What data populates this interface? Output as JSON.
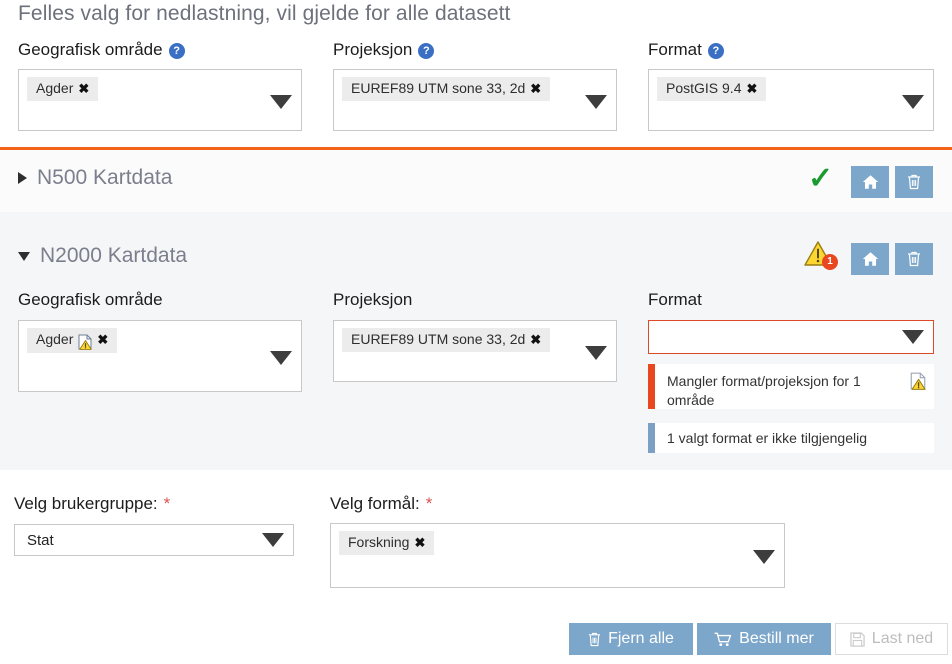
{
  "header": {
    "title": "Felles valg for nedlastning, vil gjelde for alle datasett"
  },
  "common": {
    "geo": {
      "label": "Geografisk område",
      "help": "?",
      "chips": [
        {
          "label": "Agder",
          "remove": "✖"
        }
      ]
    },
    "projection": {
      "label": "Projeksjon",
      "help": "?",
      "chips": [
        {
          "label": "EUREF89 UTM sone 33, 2d",
          "remove": "✖"
        }
      ]
    },
    "format": {
      "label": "Format",
      "help": "?",
      "chips": [
        {
          "label": "PostGIS 9.4",
          "remove": "✖"
        }
      ]
    }
  },
  "datasets": [
    {
      "name": "N500 Kartdata",
      "expanded": false,
      "toggle_glyph": "▶",
      "status": "ok",
      "status_glyph": "✓",
      "home_title": "Hjem",
      "delete_title": "Slett"
    },
    {
      "name": "N2000 Kartdata",
      "expanded": true,
      "toggle_glyph": "▼",
      "status": "warning",
      "warning_count": "1",
      "home_title": "Hjem",
      "delete_title": "Slett",
      "geo": {
        "label": "Geografisk område",
        "chips": [
          {
            "label": "Agder",
            "remove": "✖",
            "has_warning": true
          }
        ]
      },
      "projection": {
        "label": "Projeksjon",
        "chips": [
          {
            "label": "EUREF89 UTM sone 33, 2d",
            "remove": "✖"
          }
        ]
      },
      "format": {
        "label": "Format",
        "value": "",
        "error": true,
        "messages": [
          {
            "type": "error",
            "text": "Mangler format/projeksjon for 1 område"
          },
          {
            "type": "info",
            "text": "1 valgt format er ikke tilgjengelig"
          }
        ]
      }
    }
  ],
  "bottom": {
    "usergroup": {
      "label": "Velg brukergruppe:",
      "required": "*",
      "value": "Stat"
    },
    "purpose": {
      "label": "Velg formål:",
      "required": "*",
      "chips": [
        {
          "label": "Forskning",
          "remove": "✖"
        }
      ]
    }
  },
  "footer": {
    "remove_all": "Fjern alle",
    "order_more": "Bestill mer",
    "download": "Last ned"
  },
  "colors": {
    "accent_orange": "#f4631a",
    "button_blue": "#7da7ca",
    "error_red": "#e8471f",
    "info_blue": "#7ba0c4",
    "success_green": "#1a9b2f",
    "help_blue": "#3a6fc4"
  }
}
